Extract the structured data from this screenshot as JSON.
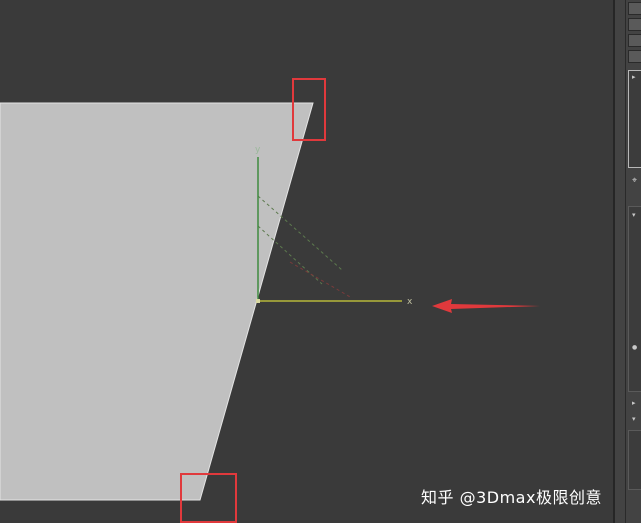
{
  "gizmo": {
    "y_label": "y",
    "x_label": "x"
  },
  "watermark": {
    "text": "知乎 @3Dmax极限创意"
  },
  "colors": {
    "viewport_bg": "#3a3a3a",
    "plane_fill": "#c0c0c0",
    "highlight_red": "#e0393c",
    "axis_y": "#3f8a3f",
    "axis_x": "#b6b83a"
  },
  "icons": [
    "arrow-icon",
    "pin-icon",
    "dropdown-icon"
  ]
}
